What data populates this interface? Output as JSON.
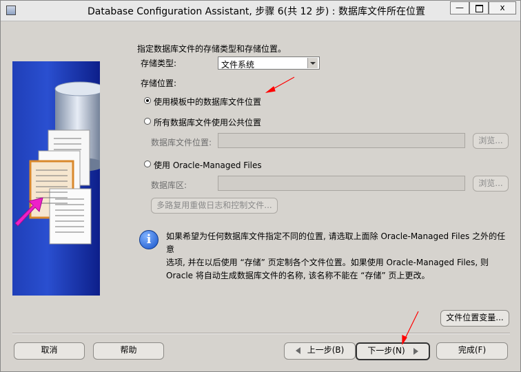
{
  "window": {
    "title": "Database Configuration Assistant, 步骤 6(共 12 步) : 数据库文件所在位置",
    "minimize": "—",
    "close": "x"
  },
  "form": {
    "heading": "指定数据库文件的存储类型和存储位置。",
    "storage_type_label": "存储类型:",
    "storage_type_value": "文件系统",
    "storage_location_label": "存储位置:",
    "options": [
      {
        "label": "使用模板中的数据库文件位置",
        "checked": true
      },
      {
        "label": "所有数据库文件使用公共位置",
        "checked": false
      },
      {
        "label": "使用 Oracle-Managed Files",
        "checked": false
      }
    ],
    "db_file_location_label": "数据库文件位置:",
    "db_area_label": "数据库区:",
    "browse_label": "浏览...",
    "multiplex_label": "多路复用重做日志和控制文件..."
  },
  "info": {
    "lines": [
      "如果希望为任何数据库文件指定不同的位置, 请选取上面除 Oracle-Managed Files 之外的任意",
      "选项, 并在以后使用 “存储” 页定制各个文件位置。如果使用 Oracle-Managed Files, 则",
      "Oracle 将自动生成数据库文件的名称, 该名称不能在 “存储” 页上更改。"
    ]
  },
  "buttons": {
    "file_location_vars": "文件位置变量...",
    "cancel": "取消",
    "help": "帮助",
    "back": "上一步(B)",
    "next": "下一步(N)",
    "finish": "完成(F)"
  },
  "colors": {
    "annotation_arrow": "#ff0000",
    "window_bg": "#d6d3ce",
    "art_bg": "#2a4fd0"
  }
}
